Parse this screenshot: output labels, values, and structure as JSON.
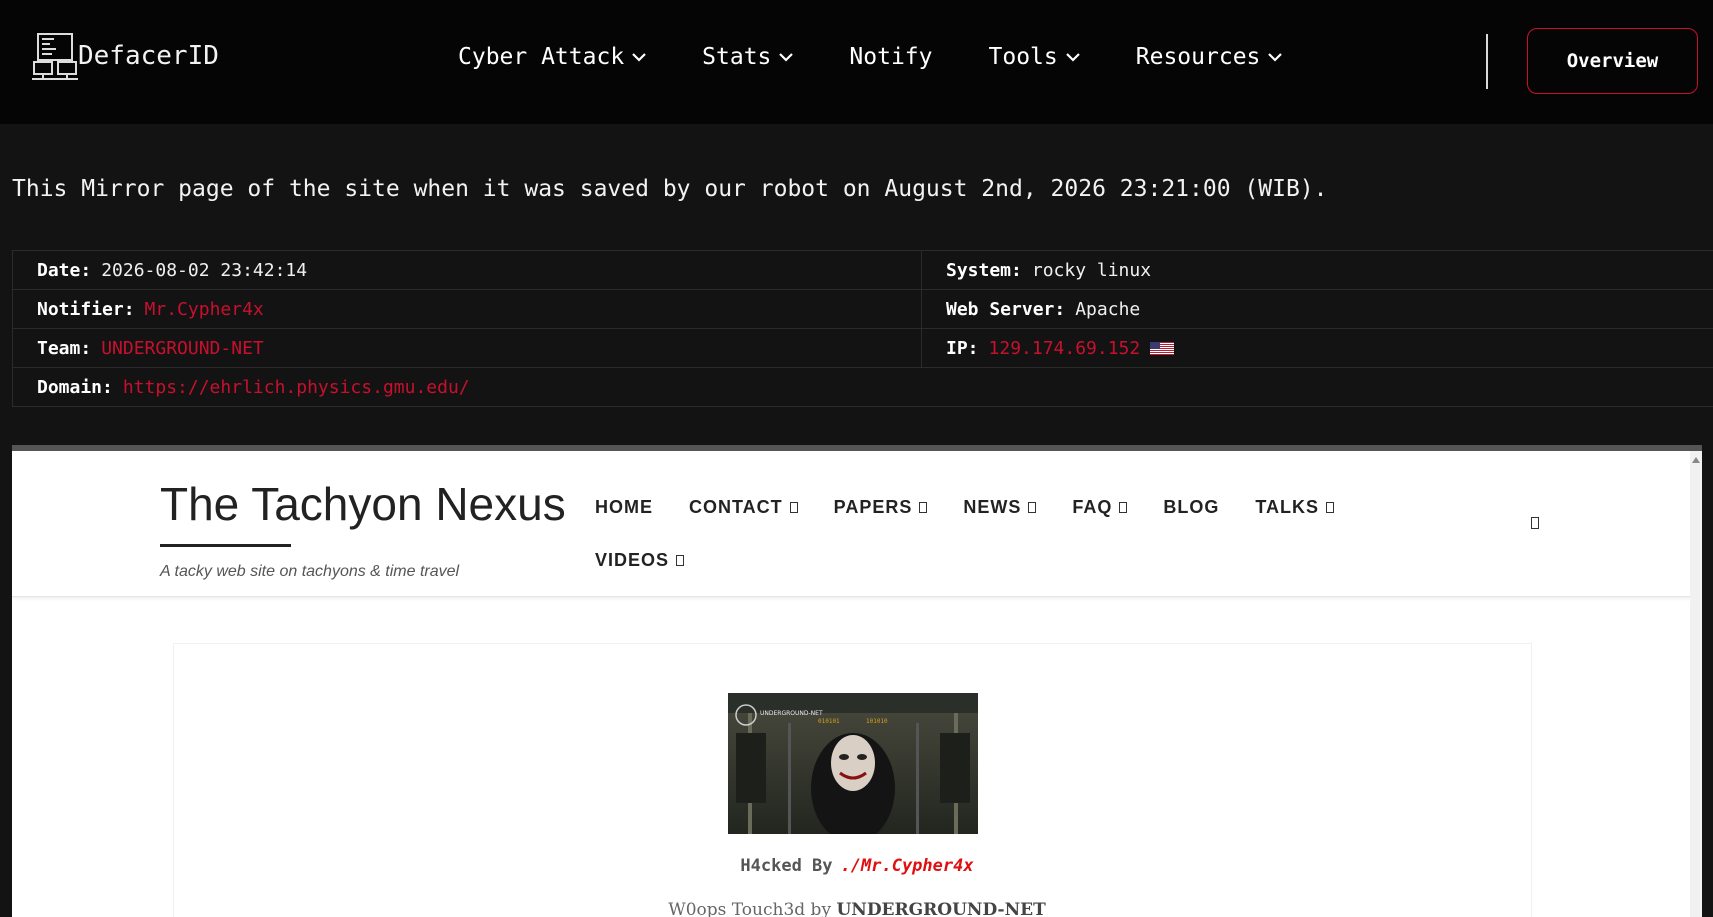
{
  "brand": {
    "name": "DefacerID"
  },
  "nav": {
    "items": [
      {
        "label": "Cyber Attack",
        "dropdown": true
      },
      {
        "label": "Stats",
        "dropdown": true
      },
      {
        "label": "Notify",
        "dropdown": false
      },
      {
        "label": "Tools",
        "dropdown": true
      },
      {
        "label": "Resources",
        "dropdown": true
      }
    ],
    "overview_label": "Overview"
  },
  "mirror_note": "This Mirror page of the site when it was saved by our robot on August 2nd, 2026 23:21:00 (WIB).",
  "info": {
    "date_label": "Date:",
    "date": "2026-08-02 23:42:14",
    "system_label": "System:",
    "system": "rocky linux",
    "notifier_label": "Notifier:",
    "notifier": "Mr.Cypher4x",
    "webserver_label": "Web Server:",
    "webserver": "Apache",
    "team_label": "Team:",
    "team": "UNDERGROUND-NET",
    "ip_label": "IP:",
    "ip": "129.174.69.152",
    "domain_label": "Domain:",
    "domain": "https://ehrlich.physics.gmu.edu/"
  },
  "mirror_site": {
    "title": "The Tachyon Nexus",
    "tagline": "A tacky web site on tachyons & time travel",
    "nav_row1": [
      {
        "label": "HOME",
        "dropdown": false
      },
      {
        "label": "CONTACT",
        "dropdown": true
      },
      {
        "label": "PAPERS",
        "dropdown": true
      },
      {
        "label": "NEWS",
        "dropdown": true
      },
      {
        "label": "FAQ",
        "dropdown": true
      },
      {
        "label": "BLOG",
        "dropdown": false
      },
      {
        "label": "TALKS",
        "dropdown": true
      }
    ],
    "nav_row2": [
      {
        "label": "VIDEOS",
        "dropdown": true
      }
    ],
    "hacked_prefix": "H4cked By",
    "hacked_name": "./Mr.Cypher4x",
    "woops_prefix": "W0ops Touch3d by",
    "woops_team": "UNDERGROUND-NET",
    "image_caption": "UNDERGROUND-NET"
  },
  "colors": {
    "accent": "#c8102e",
    "background": "#131313",
    "nav_bg": "#050505"
  }
}
